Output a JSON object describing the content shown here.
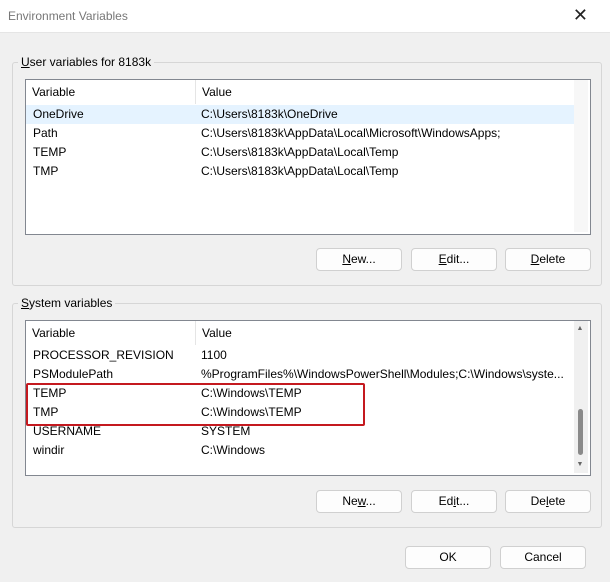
{
  "window": {
    "title": "Environment Variables",
    "close_glyph": "✕"
  },
  "user_section": {
    "label_prefix": "U",
    "label_rest": "ser variables for 8183k",
    "columns": [
      "Variable",
      "Value"
    ],
    "rows": [
      {
        "variable": "OneDrive",
        "value": "C:\\Users\\8183k\\OneDrive",
        "selected": true
      },
      {
        "variable": "Path",
        "value": "C:\\Users\\8183k\\AppData\\Local\\Microsoft\\WindowsApps;"
      },
      {
        "variable": "TEMP",
        "value": "C:\\Users\\8183k\\AppData\\Local\\Temp"
      },
      {
        "variable": "TMP",
        "value": "C:\\Users\\8183k\\AppData\\Local\\Temp"
      }
    ],
    "buttons": {
      "new_hot": "N",
      "new_rest": "ew...",
      "edit_hot": "E",
      "edit_rest": "dit...",
      "delete_hot": "D",
      "delete_rest": "elete"
    }
  },
  "system_section": {
    "label_prefix": "S",
    "label_rest": "ystem variables",
    "columns": [
      "Variable",
      "Value"
    ],
    "rows": [
      {
        "variable": "PROCESSOR_REVISION",
        "value": "1100"
      },
      {
        "variable": "PSModulePath",
        "value": "%ProgramFiles%\\WindowsPowerShell\\Modules;C:\\Windows\\syste..."
      },
      {
        "variable": "TEMP",
        "value": "C:\\Windows\\TEMP"
      },
      {
        "variable": "TMP",
        "value": "C:\\Windows\\TEMP"
      },
      {
        "variable": "USERNAME",
        "value": "SYSTEM"
      },
      {
        "variable": "windir",
        "value": "C:\\Windows"
      }
    ],
    "buttons": {
      "new_pre": "Ne",
      "new_hot": "w",
      "new_post": "...",
      "edit_pre": "Ed",
      "edit_hot": "i",
      "edit_post": "t...",
      "delete_pre": "De",
      "delete_hot": "l",
      "delete_post": "ete"
    },
    "scroll_position_fraction": 0.85
  },
  "dialog_buttons": {
    "ok": "OK",
    "cancel": "Cancel"
  },
  "colors": {
    "highlight": "#c4191f",
    "selection": "#e5f3ff"
  }
}
